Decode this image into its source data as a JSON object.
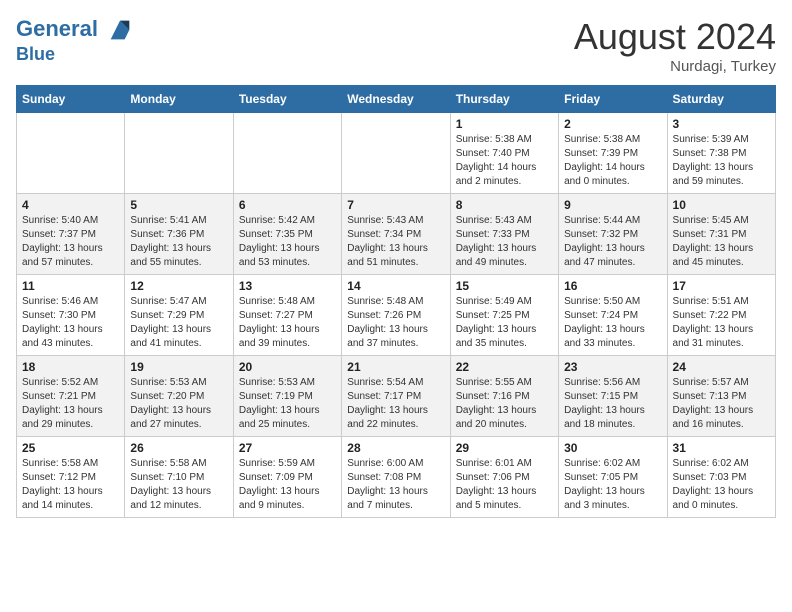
{
  "header": {
    "logo_line1": "General",
    "logo_line2": "Blue",
    "month_year": "August 2024",
    "location": "Nurdagi, Turkey"
  },
  "days_of_week": [
    "Sunday",
    "Monday",
    "Tuesday",
    "Wednesday",
    "Thursday",
    "Friday",
    "Saturday"
  ],
  "weeks": [
    [
      {
        "num": "",
        "sunrise": "",
        "sunset": "",
        "daylight": ""
      },
      {
        "num": "",
        "sunrise": "",
        "sunset": "",
        "daylight": ""
      },
      {
        "num": "",
        "sunrise": "",
        "sunset": "",
        "daylight": ""
      },
      {
        "num": "",
        "sunrise": "",
        "sunset": "",
        "daylight": ""
      },
      {
        "num": "1",
        "sunrise": "5:38 AM",
        "sunset": "7:40 PM",
        "daylight": "14 hours and 2 minutes."
      },
      {
        "num": "2",
        "sunrise": "5:38 AM",
        "sunset": "7:39 PM",
        "daylight": "14 hours and 0 minutes."
      },
      {
        "num": "3",
        "sunrise": "5:39 AM",
        "sunset": "7:38 PM",
        "daylight": "13 hours and 59 minutes."
      }
    ],
    [
      {
        "num": "4",
        "sunrise": "5:40 AM",
        "sunset": "7:37 PM",
        "daylight": "13 hours and 57 minutes."
      },
      {
        "num": "5",
        "sunrise": "5:41 AM",
        "sunset": "7:36 PM",
        "daylight": "13 hours and 55 minutes."
      },
      {
        "num": "6",
        "sunrise": "5:42 AM",
        "sunset": "7:35 PM",
        "daylight": "13 hours and 53 minutes."
      },
      {
        "num": "7",
        "sunrise": "5:43 AM",
        "sunset": "7:34 PM",
        "daylight": "13 hours and 51 minutes."
      },
      {
        "num": "8",
        "sunrise": "5:43 AM",
        "sunset": "7:33 PM",
        "daylight": "13 hours and 49 minutes."
      },
      {
        "num": "9",
        "sunrise": "5:44 AM",
        "sunset": "7:32 PM",
        "daylight": "13 hours and 47 minutes."
      },
      {
        "num": "10",
        "sunrise": "5:45 AM",
        "sunset": "7:31 PM",
        "daylight": "13 hours and 45 minutes."
      }
    ],
    [
      {
        "num": "11",
        "sunrise": "5:46 AM",
        "sunset": "7:30 PM",
        "daylight": "13 hours and 43 minutes."
      },
      {
        "num": "12",
        "sunrise": "5:47 AM",
        "sunset": "7:29 PM",
        "daylight": "13 hours and 41 minutes."
      },
      {
        "num": "13",
        "sunrise": "5:48 AM",
        "sunset": "7:27 PM",
        "daylight": "13 hours and 39 minutes."
      },
      {
        "num": "14",
        "sunrise": "5:48 AM",
        "sunset": "7:26 PM",
        "daylight": "13 hours and 37 minutes."
      },
      {
        "num": "15",
        "sunrise": "5:49 AM",
        "sunset": "7:25 PM",
        "daylight": "13 hours and 35 minutes."
      },
      {
        "num": "16",
        "sunrise": "5:50 AM",
        "sunset": "7:24 PM",
        "daylight": "13 hours and 33 minutes."
      },
      {
        "num": "17",
        "sunrise": "5:51 AM",
        "sunset": "7:22 PM",
        "daylight": "13 hours and 31 minutes."
      }
    ],
    [
      {
        "num": "18",
        "sunrise": "5:52 AM",
        "sunset": "7:21 PM",
        "daylight": "13 hours and 29 minutes."
      },
      {
        "num": "19",
        "sunrise": "5:53 AM",
        "sunset": "7:20 PM",
        "daylight": "13 hours and 27 minutes."
      },
      {
        "num": "20",
        "sunrise": "5:53 AM",
        "sunset": "7:19 PM",
        "daylight": "13 hours and 25 minutes."
      },
      {
        "num": "21",
        "sunrise": "5:54 AM",
        "sunset": "7:17 PM",
        "daylight": "13 hours and 22 minutes."
      },
      {
        "num": "22",
        "sunrise": "5:55 AM",
        "sunset": "7:16 PM",
        "daylight": "13 hours and 20 minutes."
      },
      {
        "num": "23",
        "sunrise": "5:56 AM",
        "sunset": "7:15 PM",
        "daylight": "13 hours and 18 minutes."
      },
      {
        "num": "24",
        "sunrise": "5:57 AM",
        "sunset": "7:13 PM",
        "daylight": "13 hours and 16 minutes."
      }
    ],
    [
      {
        "num": "25",
        "sunrise": "5:58 AM",
        "sunset": "7:12 PM",
        "daylight": "13 hours and 14 minutes."
      },
      {
        "num": "26",
        "sunrise": "5:58 AM",
        "sunset": "7:10 PM",
        "daylight": "13 hours and 12 minutes."
      },
      {
        "num": "27",
        "sunrise": "5:59 AM",
        "sunset": "7:09 PM",
        "daylight": "13 hours and 9 minutes."
      },
      {
        "num": "28",
        "sunrise": "6:00 AM",
        "sunset": "7:08 PM",
        "daylight": "13 hours and 7 minutes."
      },
      {
        "num": "29",
        "sunrise": "6:01 AM",
        "sunset": "7:06 PM",
        "daylight": "13 hours and 5 minutes."
      },
      {
        "num": "30",
        "sunrise": "6:02 AM",
        "sunset": "7:05 PM",
        "daylight": "13 hours and 3 minutes."
      },
      {
        "num": "31",
        "sunrise": "6:02 AM",
        "sunset": "7:03 PM",
        "daylight": "13 hours and 0 minutes."
      }
    ]
  ],
  "labels": {
    "sunrise_label": "Sunrise:",
    "sunset_label": "Sunset:",
    "daylight_label": "Daylight:"
  }
}
